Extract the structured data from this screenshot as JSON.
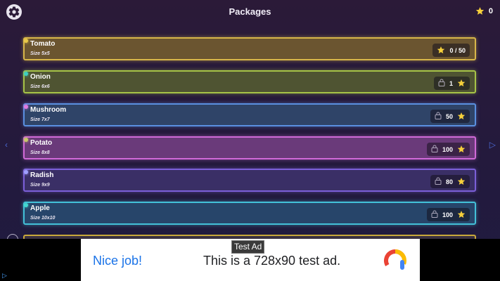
{
  "header": {
    "title": "Packages",
    "stars_total": "0"
  },
  "packages": [
    {
      "name": "Tomato",
      "size": "Size 5x5",
      "progress": "0 / 50",
      "locked": false,
      "bg": "#6b5530",
      "border": "#d8b64a",
      "dot": "#e8c84a"
    },
    {
      "name": "Onion",
      "size": "Size 6x6",
      "progress": "1",
      "locked": true,
      "bg": "#4f5432",
      "border": "#a6c347",
      "dot": "#3ed0c0"
    },
    {
      "name": "Mushroom",
      "size": "Size 7x7",
      "progress": "50",
      "locked": true,
      "bg": "#2f4468",
      "border": "#5a8fe0",
      "dot": "#e07ae0"
    },
    {
      "name": "Potato",
      "size": "Size 8x8",
      "progress": "100",
      "locked": true,
      "bg": "#6a3a7a",
      "border": "#d06ad8",
      "dot": "#c8c86a"
    },
    {
      "name": "Radish",
      "size": "Size 9x9",
      "progress": "80",
      "locked": true,
      "bg": "#3a2f66",
      "border": "#7b5fd8",
      "dot": "#a0a0ff"
    },
    {
      "name": "Apple",
      "size": "Size 10x10",
      "progress": "100",
      "locked": true,
      "bg": "#27456a",
      "border": "#43c0d8",
      "dot": "#43d8d0"
    }
  ],
  "ad": {
    "tag": "Test Ad",
    "headline": "Nice job!",
    "text": "This is a 728x90 test ad."
  },
  "colors": {
    "accent_star": "#f6d03b"
  }
}
